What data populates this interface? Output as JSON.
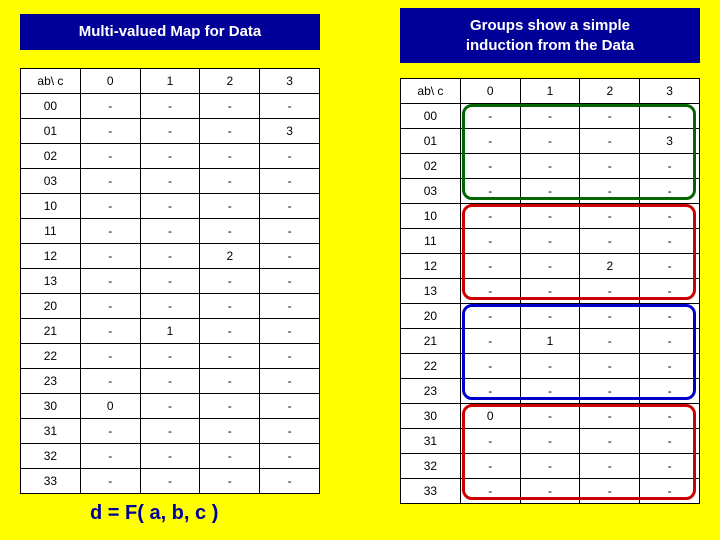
{
  "title_left": "Multi-valued Map for Data",
  "title_right_line1": "Groups show a simple",
  "title_right_line2": "induction from the Data",
  "formula": "d = F( a, b, c )",
  "header": [
    "ab\\ c",
    "0",
    "1",
    "2",
    "3"
  ],
  "rows": [
    {
      "label": "00",
      "cells": [
        "-",
        "-",
        "-",
        "-"
      ]
    },
    {
      "label": "01",
      "cells": [
        "-",
        "-",
        "-",
        "3"
      ]
    },
    {
      "label": "02",
      "cells": [
        "-",
        "-",
        "-",
        "-"
      ]
    },
    {
      "label": "03",
      "cells": [
        "-",
        "-",
        "-",
        "-"
      ]
    },
    {
      "label": "10",
      "cells": [
        "-",
        "-",
        "-",
        "-"
      ]
    },
    {
      "label": "11",
      "cells": [
        "-",
        "-",
        "-",
        "-"
      ]
    },
    {
      "label": "12",
      "cells": [
        "-",
        "-",
        "2",
        "-"
      ]
    },
    {
      "label": "13",
      "cells": [
        "-",
        "-",
        "-",
        "-"
      ]
    },
    {
      "label": "20",
      "cells": [
        "-",
        "-",
        "-",
        "-"
      ]
    },
    {
      "label": "21",
      "cells": [
        "-",
        "1",
        "-",
        "-"
      ]
    },
    {
      "label": "22",
      "cells": [
        "-",
        "-",
        "-",
        "-"
      ]
    },
    {
      "label": "23",
      "cells": [
        "-",
        "-",
        "-",
        "-"
      ]
    },
    {
      "label": "30",
      "cells": [
        "0",
        "-",
        "-",
        "-"
      ]
    },
    {
      "label": "31",
      "cells": [
        "-",
        "-",
        "-",
        "-"
      ]
    },
    {
      "label": "32",
      "cells": [
        "-",
        "-",
        "-",
        "-"
      ]
    },
    {
      "label": "33",
      "cells": [
        "-",
        "-",
        "-",
        "-"
      ]
    }
  ],
  "highlights": [
    {
      "color": "#006600",
      "top_row": 0,
      "rows": 4,
      "left_col": 1,
      "cols": 4
    },
    {
      "color": "#cc0000",
      "top_row": 4,
      "rows": 4,
      "left_col": 1,
      "cols": 4
    },
    {
      "color": "#0000cc",
      "top_row": 8,
      "rows": 4,
      "left_col": 1,
      "cols": 4
    },
    {
      "color": "#cc0000",
      "top_row": 12,
      "rows": 4,
      "left_col": 1,
      "cols": 4
    }
  ],
  "chart_data": {
    "type": "table",
    "description": "Multi-valued Karnaugh-style map; variables a,b (rows 0-3 each) vs c (columns 0-3); output d",
    "row_var": "ab",
    "col_var": "c",
    "row_labels": [
      "00",
      "01",
      "02",
      "03",
      "10",
      "11",
      "12",
      "13",
      "20",
      "21",
      "22",
      "23",
      "30",
      "31",
      "32",
      "33"
    ],
    "col_labels": [
      "0",
      "1",
      "2",
      "3"
    ],
    "values": [
      [
        "-",
        "-",
        "-",
        "-"
      ],
      [
        "-",
        "-",
        "-",
        "3"
      ],
      [
        "-",
        "-",
        "-",
        "-"
      ],
      [
        "-",
        "-",
        "-",
        "-"
      ],
      [
        "-",
        "-",
        "-",
        "-"
      ],
      [
        "-",
        "-",
        "-",
        "-"
      ],
      [
        "-",
        "-",
        "2",
        "-"
      ],
      [
        "-",
        "-",
        "-",
        "-"
      ],
      [
        "-",
        "-",
        "-",
        "-"
      ],
      [
        "-",
        "1",
        "-",
        "-"
      ],
      [
        "-",
        "-",
        "-",
        "-"
      ],
      [
        "-",
        "-",
        "-",
        "-"
      ],
      [
        "0",
        "-",
        "-",
        "-"
      ],
      [
        "-",
        "-",
        "-",
        "-"
      ],
      [
        "-",
        "-",
        "-",
        "-"
      ],
      [
        "-",
        "-",
        "-",
        "-"
      ]
    ]
  }
}
